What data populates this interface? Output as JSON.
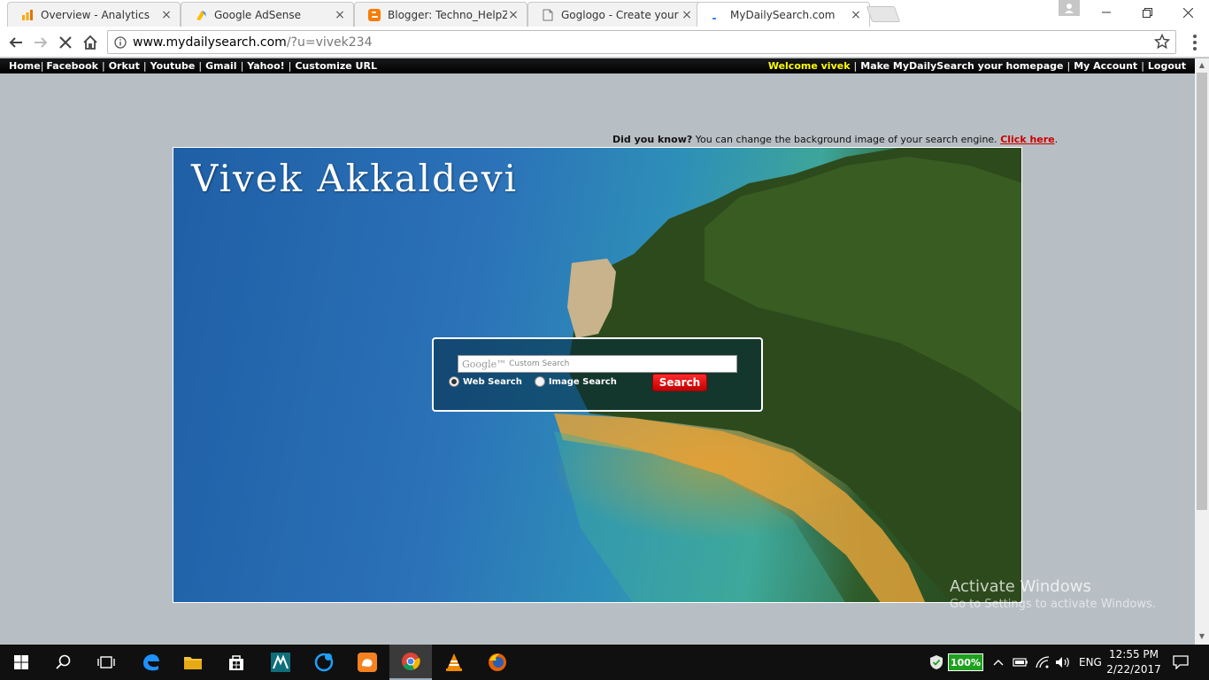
{
  "browser": {
    "tabs": [
      {
        "title": "Overview - Analytics",
        "icon": "analytics-icon",
        "active": false
      },
      {
        "title": "Google AdSense",
        "icon": "adsense-icon",
        "active": false
      },
      {
        "title": "Blogger: Techno_HelpZo",
        "icon": "blogger-icon",
        "active": false
      },
      {
        "title": "Goglogo - Create your O",
        "icon": "page-icon",
        "active": false
      },
      {
        "title": "MyDailySearch.com",
        "icon": "loading-icon",
        "active": true
      }
    ],
    "close_glyph": "×",
    "url_host": "www.mydailysearch.com",
    "url_path": "/?u=vivek234"
  },
  "site": {
    "nav_left": [
      "Home",
      "Facebook",
      "Orkut",
      "Youtube",
      "Gmail",
      "Yahoo!",
      "Customize URL"
    ],
    "welcome": "Welcome vivek",
    "nav_right": [
      "Make MyDailySearch your homepage",
      "My Account",
      "Logout"
    ],
    "did_you_know": {
      "label": "Did you know?",
      "text": " You can change the background image of your search engine. ",
      "link": "Click here",
      "end": "."
    },
    "hero_name": "Vivek Akkaldevi",
    "search": {
      "google_label": "Google™",
      "placeholder": "Custom Search",
      "option_web": "Web Search",
      "option_image": "Image Search",
      "selected": "web",
      "button": "Search"
    }
  },
  "os": {
    "watermark_title": "Activate Windows",
    "watermark_sub": "Go to Settings to activate Windows.",
    "battery": "100%",
    "language": "ENG",
    "time": "12:55 PM",
    "date": "2/22/2017"
  },
  "colors": {
    "welcome": "#ffff00",
    "link_red": "#cc0000",
    "search_button": "#e00000",
    "page_background": "#b7bfc4",
    "battery": "#1ea11e"
  }
}
